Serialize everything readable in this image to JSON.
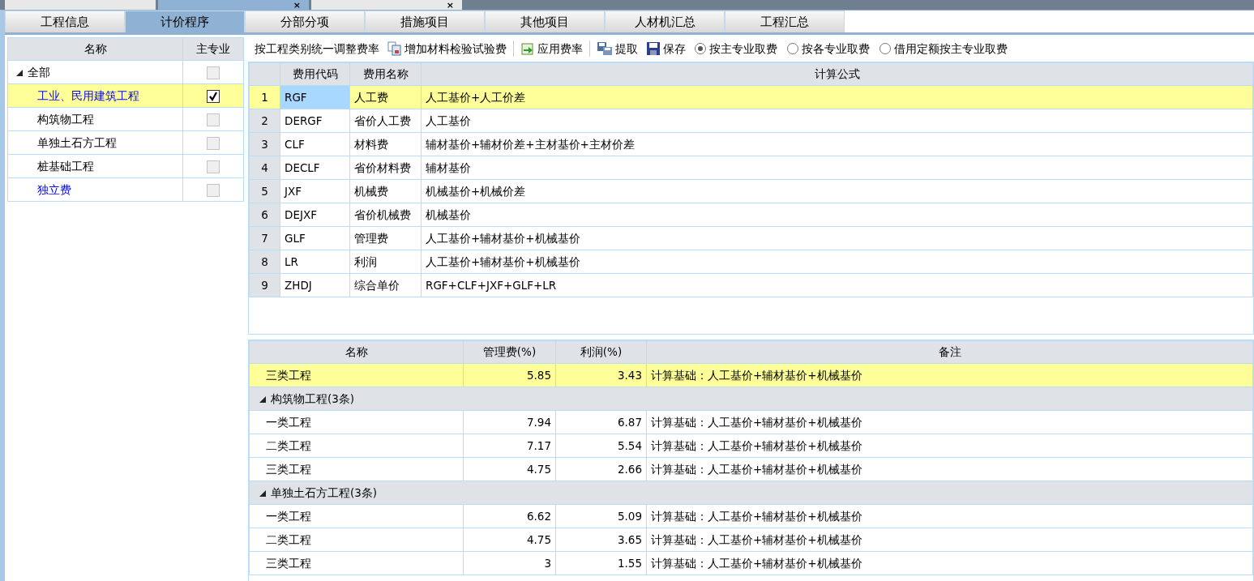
{
  "doc_tabs": [
    {
      "selected": false
    },
    {
      "selected": true,
      "close": "×"
    },
    {
      "selected": false,
      "close": "×"
    }
  ],
  "module_tabs": [
    {
      "label": "工程信息",
      "selected": false
    },
    {
      "label": "计价程序",
      "selected": true
    },
    {
      "label": "分部分项",
      "selected": false
    },
    {
      "label": "措施项目",
      "selected": false
    },
    {
      "label": "其他项目",
      "selected": false
    },
    {
      "label": "人材机汇总",
      "selected": false
    },
    {
      "label": "工程汇总",
      "selected": false
    }
  ],
  "specialty_tree": {
    "columns": [
      "名称",
      "主专业"
    ],
    "items": [
      {
        "kind": "plain",
        "name": "全部",
        "expanded": true,
        "checked": false,
        "selected": false,
        "children": [
          {
            "kind": "link",
            "name": "工业、民用建筑工程",
            "checked": true,
            "selected": true
          },
          {
            "kind": "plain",
            "name": "构筑物工程",
            "checked": false,
            "selected": false
          },
          {
            "kind": "plain",
            "name": "单独土石方工程",
            "checked": false,
            "selected": false
          },
          {
            "kind": "plain",
            "name": "桩基础工程",
            "checked": false,
            "selected": false
          },
          {
            "kind": "link",
            "name": "独立费",
            "checked": false,
            "selected": false
          }
        ]
      }
    ]
  },
  "toolbar": {
    "buttons": [
      {
        "kind": "text",
        "label": "按工程类别统一调整费率"
      },
      {
        "kind": "copy",
        "label": "增加材料检验试验费"
      },
      {
        "kind": "apply",
        "label": "应用费率"
      },
      {
        "kind": "extract",
        "label": "提取"
      },
      {
        "kind": "save",
        "label": "保存"
      }
    ],
    "radios": [
      {
        "label": "按主专业取费",
        "selected": true
      },
      {
        "label": "按各专业取费",
        "selected": false
      },
      {
        "label": "借用定额按主专业取费",
        "selected": false
      }
    ]
  },
  "fee_table": {
    "columns": [
      "费用代码",
      "费用名称",
      "计算公式"
    ],
    "rows": [
      {
        "no": "1",
        "code": "RGF",
        "name": "人工费",
        "formula": "人工基价+人工价差",
        "selected": true
      },
      {
        "no": "2",
        "code": "DERGF",
        "name": "省价人工费",
        "formula": "人工基价",
        "selected": false
      },
      {
        "no": "3",
        "code": "CLF",
        "name": "材料费",
        "formula": "辅材基价+辅材价差+主材基价+主材价差",
        "selected": false
      },
      {
        "no": "4",
        "code": "DECLF",
        "name": "省价材料费",
        "formula": "辅材基价",
        "selected": false
      },
      {
        "no": "5",
        "code": "JXF",
        "name": "机械费",
        "formula": "机械基价+机械价差",
        "selected": false
      },
      {
        "no": "6",
        "code": "DEJXF",
        "name": "省价机械费",
        "formula": "机械基价",
        "selected": false
      },
      {
        "no": "7",
        "code": "GLF",
        "name": "管理费",
        "formula": "人工基价+辅材基价+机械基价",
        "selected": false
      },
      {
        "no": "8",
        "code": "LR",
        "name": "利润",
        "formula": "人工基价+辅材基价+机械基价",
        "selected": false
      },
      {
        "no": "9",
        "code": "ZHDJ",
        "name": "综合单价",
        "formula": "RGF+CLF+JXF+GLF+LR",
        "selected": false
      }
    ]
  },
  "rate_table": {
    "columns": [
      "名称",
      "管理费(%)",
      "利润(%)",
      "备注"
    ],
    "rows": [
      {
        "kind": "row",
        "name": "三类工程",
        "mgmt": "5.85",
        "profit": "3.43",
        "note": "计算基础：人工基价+辅材基价+机械基价",
        "selected": true
      },
      {
        "kind": "group",
        "name": "构筑物工程(3条)",
        "expanded": true
      },
      {
        "kind": "row",
        "name": "一类工程",
        "mgmt": "7.94",
        "profit": "6.87",
        "note": "计算基础：人工基价+辅材基价+机械基价",
        "selected": false
      },
      {
        "kind": "row",
        "name": "二类工程",
        "mgmt": "7.17",
        "profit": "5.54",
        "note": "计算基础：人工基价+辅材基价+机械基价",
        "selected": false
      },
      {
        "kind": "row",
        "name": "三类工程",
        "mgmt": "4.75",
        "profit": "2.66",
        "note": "计算基础：人工基价+辅材基价+机械基价",
        "selected": false
      },
      {
        "kind": "group",
        "name": "单独土石方工程(3条)",
        "expanded": true
      },
      {
        "kind": "row",
        "name": "一类工程",
        "mgmt": "6.62",
        "profit": "5.09",
        "note": "计算基础：人工基价+辅材基价+机械基价",
        "selected": false
      },
      {
        "kind": "row",
        "name": "二类工程",
        "mgmt": "4.75",
        "profit": "3.65",
        "note": "计算基础：人工基价+辅材基价+机械基价",
        "selected": false
      },
      {
        "kind": "row",
        "name": "三类工程",
        "mgmt": "3",
        "profit": "1.55",
        "note": "计算基础：人工基价+辅材基价+机械基价",
        "selected": false
      }
    ]
  }
}
